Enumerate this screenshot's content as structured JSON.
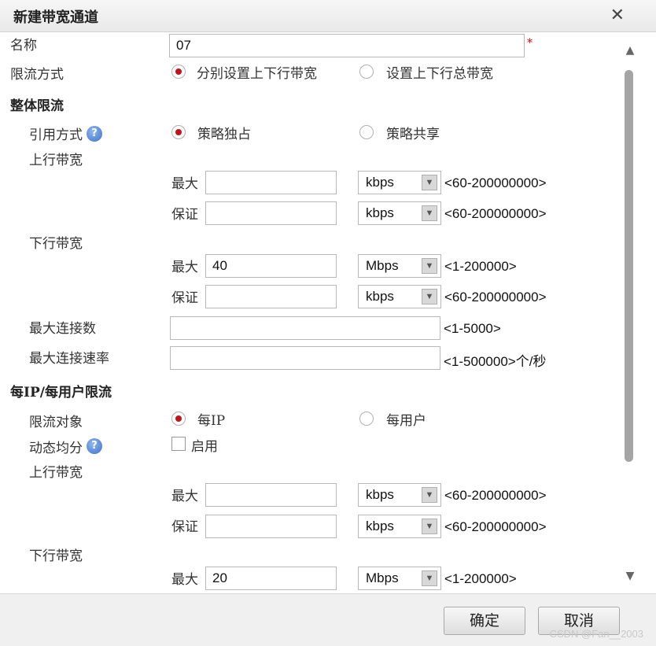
{
  "dialog": {
    "title": "新建带宽通道"
  },
  "form": {
    "name_label": "名称",
    "name_value": "07",
    "required_mark": "*",
    "mode_label": "限流方式",
    "mode_opt1": "分别设置上下行带宽",
    "mode_opt2": "设置上下行总带宽",
    "overall_section": "整体限流",
    "ref_label": "引用方式",
    "ref_opt1": "策略独占",
    "ref_opt2": "策略共享",
    "up_label": "上行带宽",
    "down_label": "下行带宽",
    "max_label": "最大",
    "guarantee_label": "保证",
    "up_max": {
      "value": "",
      "unit": "kbps",
      "range": "<60-200000000>"
    },
    "up_guarantee": {
      "value": "",
      "unit": "kbps",
      "range": "<60-200000000>"
    },
    "down_max": {
      "value": "40",
      "unit": "Mbps",
      "range": "<1-200000>"
    },
    "down_guarantee": {
      "value": "",
      "unit": "kbps",
      "range": "<60-200000000>"
    },
    "max_conn_label": "最大连接数",
    "max_conn_range": "<1-5000>",
    "max_conn_rate_label": "最大连接速率",
    "max_conn_rate_range": "<1-500000>个/秒",
    "per_section": "每IP/每用户限流",
    "target_label": "限流对象",
    "target_opt1": "每IP",
    "target_opt2": "每用户",
    "dynamic_label": "动态均分",
    "dynamic_check_label": "启用",
    "per_up_label": "上行带宽",
    "per_down_label": "下行带宽",
    "per_up_max": {
      "value": "",
      "unit": "kbps",
      "range": "<60-200000000>"
    },
    "per_up_guarantee": {
      "value": "",
      "unit": "kbps",
      "range": "<60-200000000>"
    },
    "per_down_max": {
      "value": "20",
      "unit": "Mbps",
      "range": "<1-200000>"
    }
  },
  "buttons": {
    "ok": "确定",
    "cancel": "取消"
  },
  "watermark": "CSDN @Fan__2003",
  "icons": {
    "help": "help-icon",
    "close": "close-icon",
    "dropdown": "chevron-down-icon"
  },
  "colors": {
    "radio_selected": "#c0141b",
    "help_icon": "#3e72c7"
  }
}
